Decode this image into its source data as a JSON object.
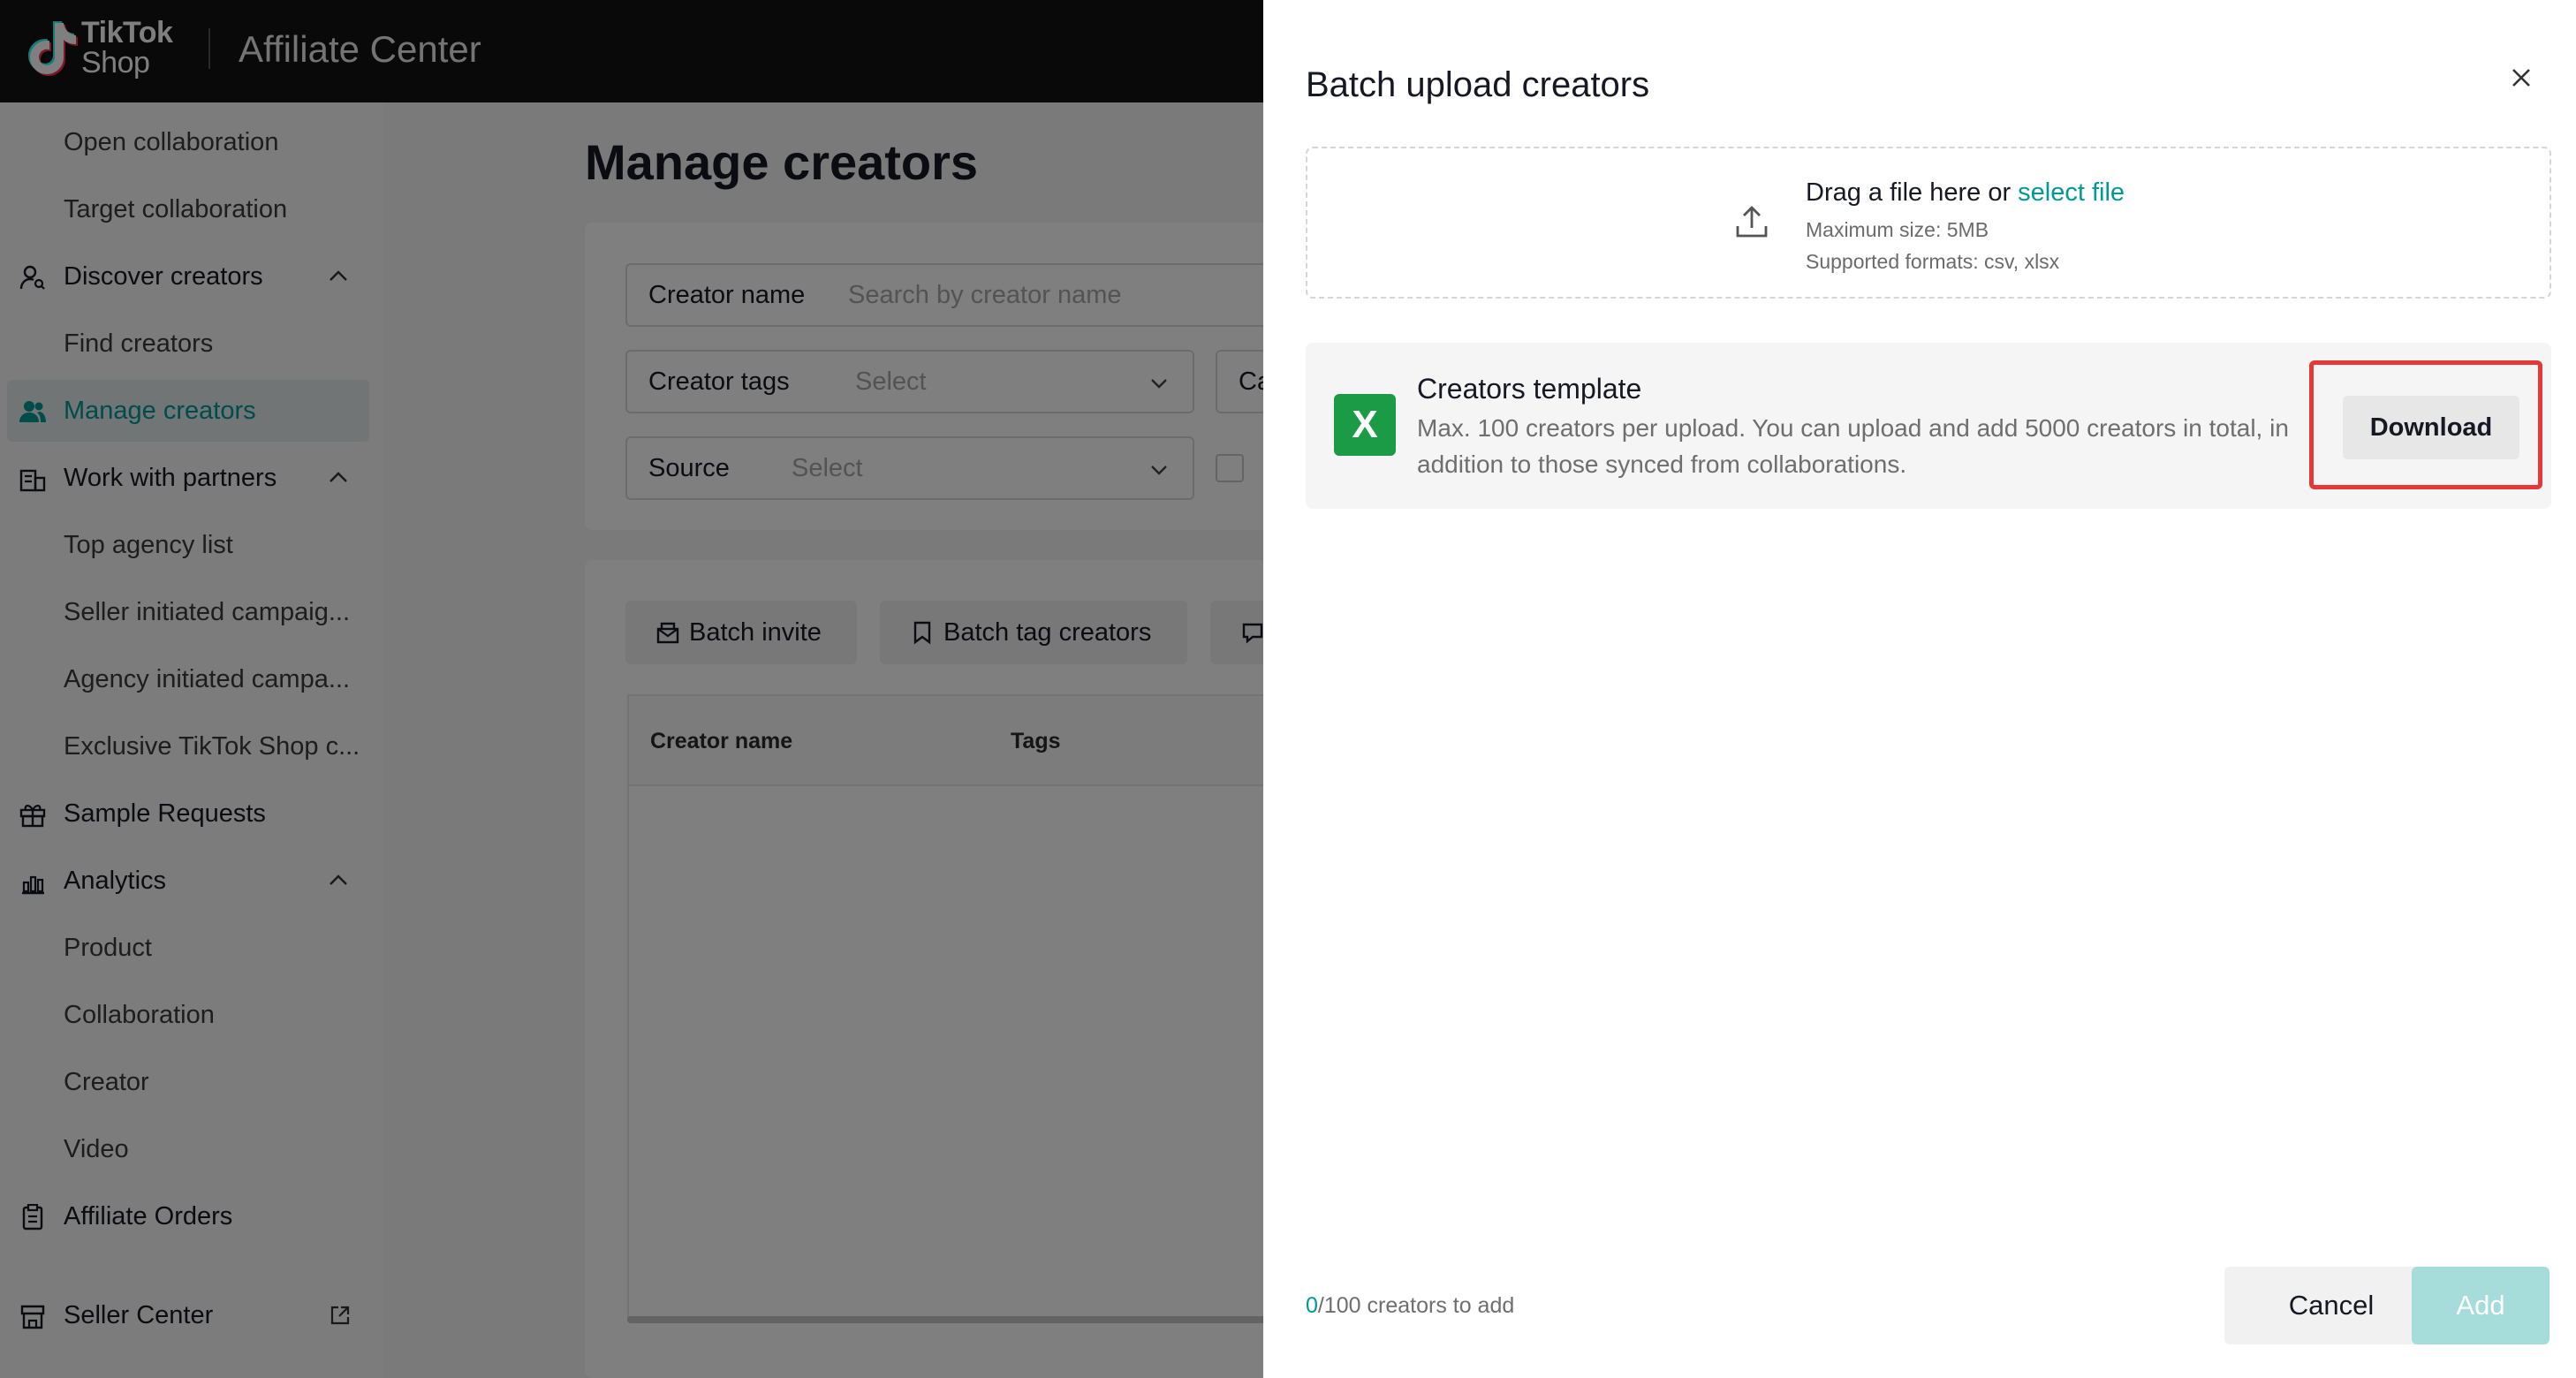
{
  "topbar": {
    "logo_line1": "TikTok",
    "logo_line2": "Shop",
    "app_title": "Affiliate Center"
  },
  "sidebar": {
    "items": [
      {
        "label": "Open collaboration",
        "type": "sub"
      },
      {
        "label": "Target collaboration",
        "type": "sub"
      },
      {
        "label": "Discover creators",
        "type": "group",
        "icon": "person-search-icon"
      },
      {
        "label": "Find creators",
        "type": "sub"
      },
      {
        "label": "Manage creators",
        "type": "active",
        "icon": "users-icon"
      },
      {
        "label": "Work with partners",
        "type": "group",
        "icon": "partners-icon"
      },
      {
        "label": "Top agency list",
        "type": "sub"
      },
      {
        "label": "Seller initiated campaig...",
        "type": "sub"
      },
      {
        "label": "Agency initiated campa...",
        "type": "sub"
      },
      {
        "label": "Exclusive TikTok Shop c...",
        "type": "sub"
      },
      {
        "label": "Sample Requests",
        "type": "top",
        "icon": "gift-icon"
      },
      {
        "label": "Analytics",
        "type": "group",
        "icon": "analytics-icon"
      },
      {
        "label": "Product",
        "type": "sub"
      },
      {
        "label": "Collaboration",
        "type": "sub"
      },
      {
        "label": "Creator",
        "type": "sub"
      },
      {
        "label": "Video",
        "type": "sub"
      },
      {
        "label": "Affiliate Orders",
        "type": "top",
        "icon": "clipboard-icon"
      },
      {
        "label": "Seller Center",
        "type": "top",
        "icon": "store-icon"
      }
    ]
  },
  "main": {
    "title": "Manage creators",
    "filters": {
      "creator_name_label": "Creator name",
      "creator_name_placeholder": "Search by creator name",
      "creator_tags_label": "Creator tags",
      "creator_tags_placeholder": "Select",
      "source_label": "Source",
      "source_placeholder": "Select",
      "partial_field_label": "Ca"
    },
    "actions": {
      "batch_invite": "Batch invite",
      "batch_tag": "Batch tag creators"
    },
    "table": {
      "columns": [
        "Creator name",
        "Tags"
      ]
    }
  },
  "drawer": {
    "title": "Batch upload creators",
    "dropzone": {
      "prompt": "Drag a file here or ",
      "link": "select file",
      "max_size": "Maximum size: 5MB",
      "formats": "Supported formats: csv, xlsx"
    },
    "template": {
      "icon_letter": "X",
      "title": "Creators template",
      "description": "Max. 100 creators per upload. You can upload and add 5000 creators in total, in addition to those synced from collaborations.",
      "download_label": "Download"
    },
    "footer": {
      "count": "0",
      "count_suffix": "/100 creators to add",
      "cancel_label": "Cancel",
      "add_label": "Add"
    }
  },
  "colors": {
    "accent": "#009995",
    "highlight": "#e53935",
    "excel_green": "#1c9b47"
  }
}
